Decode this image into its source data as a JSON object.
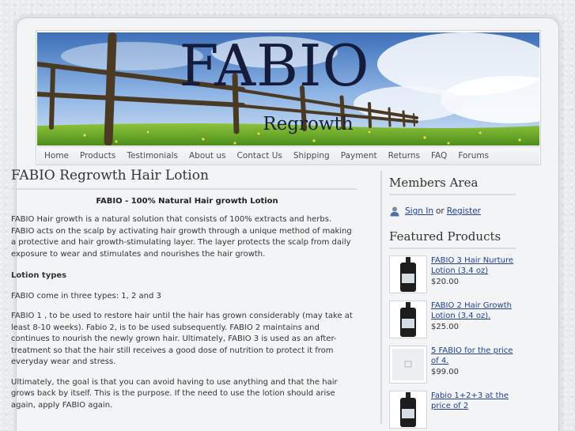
{
  "site": {
    "logo_title": "FABIO",
    "logo_subtitle": "Regrowth"
  },
  "nav": [
    "Home",
    "Products",
    "Testimonials",
    "About us",
    "Contact Us",
    "Shipping",
    "Payment",
    "Returns",
    "FAQ",
    "Forums"
  ],
  "article": {
    "title": "FABIO Regrowth Hair Lotion",
    "lead": "FABIO - 100% Natural Hair growth Lotion",
    "p1": "FABIO Hair growth is a natural solution that consists of 100% extracts and herbs. FABIO acts on the scalp by activating hair growth through a unique method of making a protective and hair growth-stimulating layer. The layer protects the scalp from daily exposure to wear and stimulates and nourishes the hair growth.",
    "subheading": "Lotion types",
    "p2": "FABIO come in three types: 1, 2 and 3",
    "p3": "FABIO 1 , to be used to restore hair until the hair has grown considerably (may take at least 8-10 weeks). Fabio 2, is to be used subsequently. FABIO 2 maintains and continues to nourish the newly grown hair. Ultimately, FABIO 3 is used as an after-treatment so that the hair still receives a good dose of nutrition to protect it from everyday wear and stress.",
    "p4": "Ultimately, the goal is that you can avoid having to use anything and that the hair grows back by itself. This is the purpose. If the need to use the lotion should arise again, apply FABIO again."
  },
  "sidebar": {
    "members_title": "Members Area",
    "sign_in": "Sign In",
    "or": "or",
    "register": "Register",
    "featured_title": "Featured Products",
    "products": [
      {
        "name": "FABIO 3 Hair Nurture Lotion (3.4 oz)",
        "price": "$20.00",
        "thumb": "bottle-icon"
      },
      {
        "name": "FABIO 2 Hair Growth Lotion (3.4 oz).",
        "price": "$25.00",
        "thumb": "bottle-icon"
      },
      {
        "name": "5 FABIO for the price of 4.",
        "price": "$99.00",
        "thumb": "image-placeholder-icon"
      },
      {
        "name": "Fabio 1+2+3 at the price of 2",
        "price": "",
        "thumb": "bottle-icon"
      }
    ]
  },
  "colors": {
    "link": "#1f3f8f",
    "title_dark": "#151b3a",
    "page_bg": "#f3f4f5"
  }
}
